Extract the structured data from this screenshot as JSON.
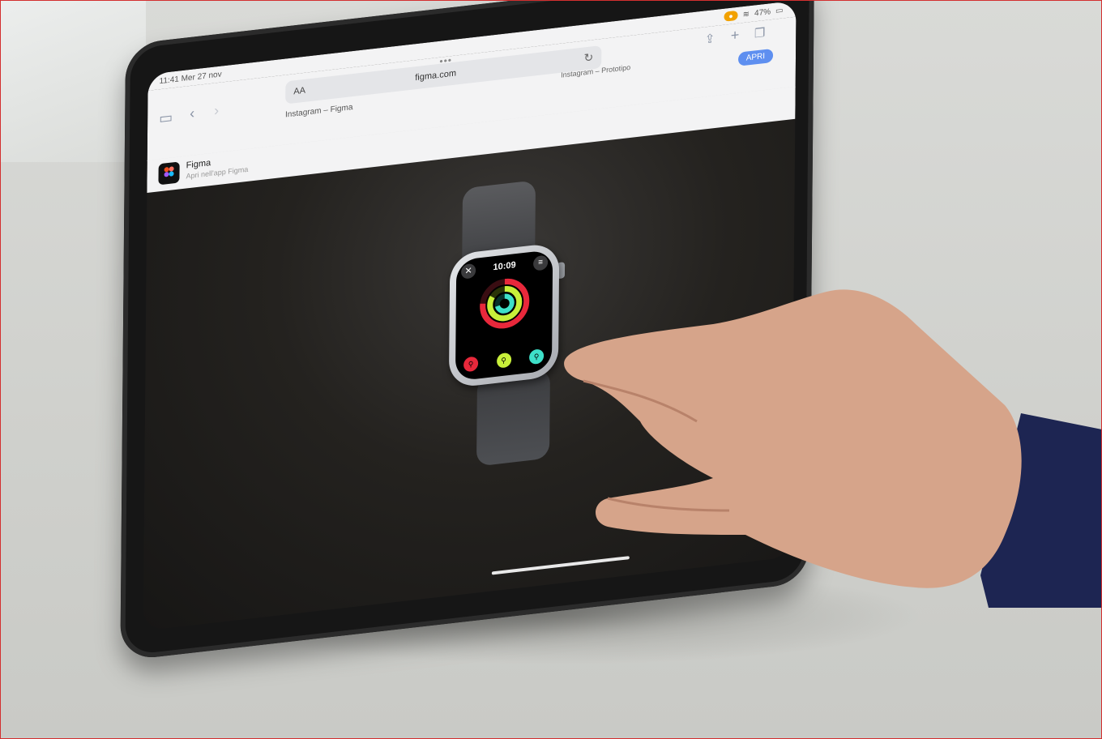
{
  "status_bar": {
    "time_date": "11:41  Mer 27 nov",
    "battery_label": "47%"
  },
  "browser": {
    "address_aa": "AA",
    "url": "figma.com",
    "dots": "•••",
    "tab_title": "Instagram – Figma",
    "tab_prototype": "Instagram – Prototipo",
    "open_button": "APRI"
  },
  "app_banner": {
    "title": "Figma",
    "subtitle": "Apri nell'app Figma"
  },
  "watch": {
    "time": "10:09",
    "ring_colors": [
      "#e8283b",
      "#c8f03a",
      "#3ee0c9"
    ]
  },
  "icons": {
    "sidebar": "sidebar-icon",
    "back": "back-arrow-icon",
    "forward": "forward-arrow-icon",
    "share": "share-icon",
    "new_tab": "plus-icon",
    "tabs": "tabs-icon",
    "reader": "reader-icon",
    "reload": "reload-icon"
  }
}
